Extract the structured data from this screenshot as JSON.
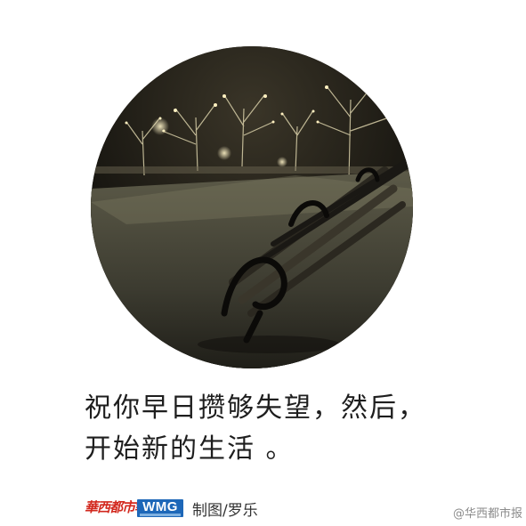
{
  "photo": {
    "scene": "night-park-bench"
  },
  "quote": {
    "line1": "祝你早日攒够失望，然后，",
    "line2": "开始新的生活 。"
  },
  "footer": {
    "brand_logo": "華西都市報",
    "wmg_logo": "WMG",
    "credit": "制图/罗乐",
    "watermark": "@华西都市报"
  },
  "colors": {
    "text": "#1e1e1e",
    "brand_red": "#d2281e",
    "wmg_blue": "#1d67b8",
    "watermark_gray": "#8c8c8c"
  }
}
